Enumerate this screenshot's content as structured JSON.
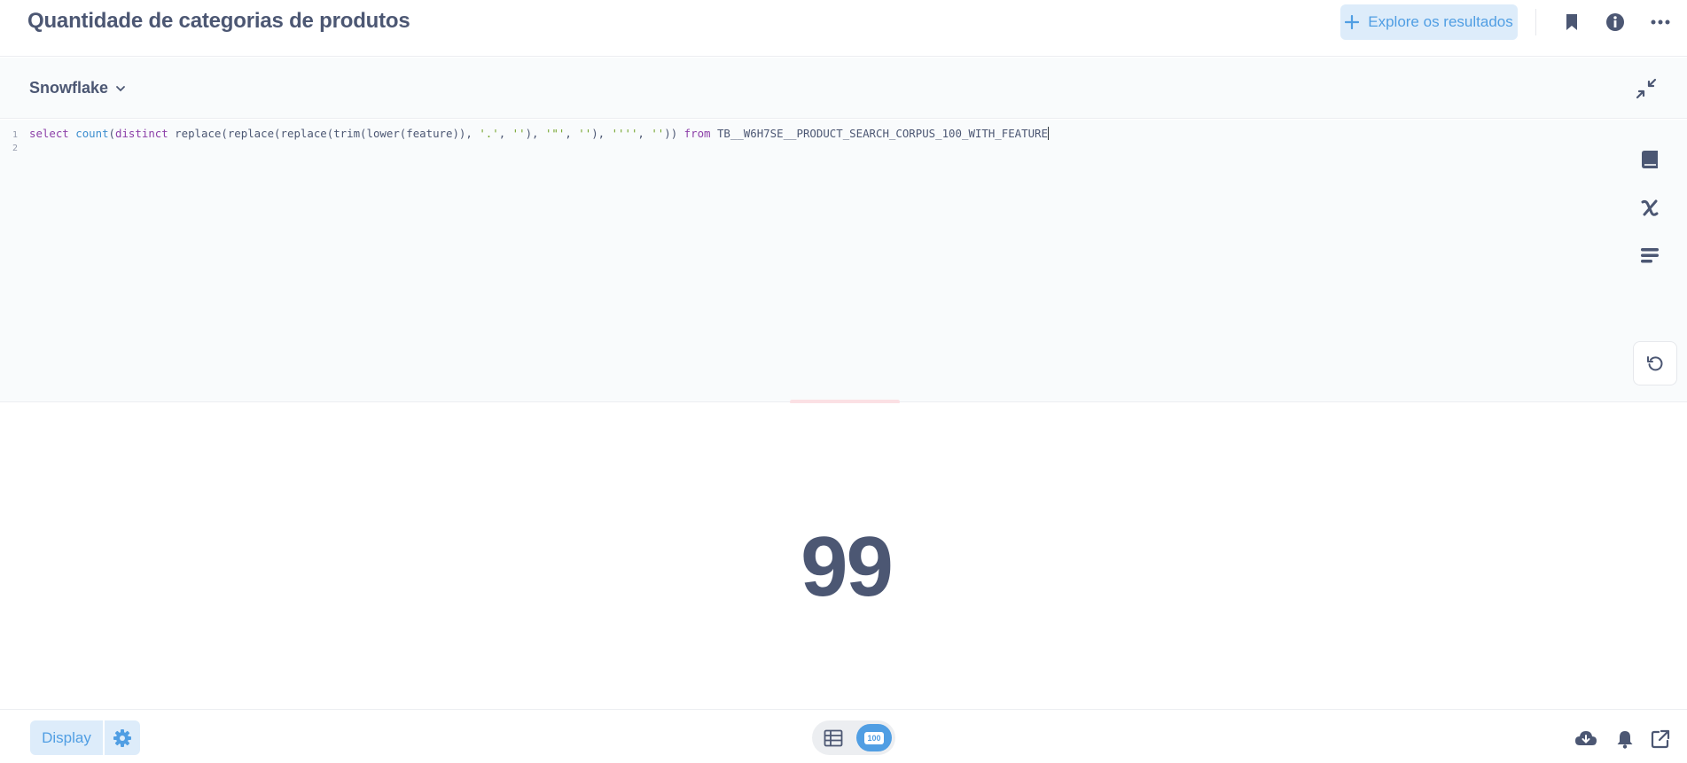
{
  "header": {
    "title": "Quantidade de categorias de produtos",
    "explore_label": "Explore os resultados"
  },
  "editor": {
    "database": "Snowflake",
    "line_numbers": [
      "1",
      "2"
    ],
    "sql": {
      "kw_select": "select",
      "fn_count": "count",
      "open_paren": "(",
      "kw_distinct": "distinct",
      "body1": " replace(replace(replace(trim(lower(feature)), ",
      "str1": "'.'",
      "sep1": ", ",
      "str2": "''",
      "sep2": "), ",
      "str3": "'\"'",
      "sep3": ", ",
      "str4": "''",
      "sep4": "), ",
      "str5": "''''",
      "sep5": ", ",
      "str6": "''",
      "close": "))",
      "kw_from": "from",
      "table": "TB__W6H7SE__PRODUCT_SEARCH_CORPUS_100_WITH_FEATURE"
    }
  },
  "result": {
    "value": "99"
  },
  "footer": {
    "display_label": "Display",
    "row_limit_badge": "100"
  },
  "icons": {
    "header": [
      "sparkle-icon",
      "bookmark-icon",
      "info-icon",
      "more-icon"
    ],
    "editor": [
      "chevron-down-icon",
      "collapse-icon",
      "data-reference-icon",
      "variable-icon",
      "snippet-icon",
      "refresh-icon"
    ],
    "footer": [
      "gear-icon",
      "table-icon",
      "download-icon",
      "bell-icon",
      "share-icon"
    ]
  },
  "colors": {
    "brand": "#509ee3",
    "text": "#4c5773",
    "keyword": "#8c3fa8",
    "function": "#3d8ecf",
    "string": "#72a32a"
  }
}
